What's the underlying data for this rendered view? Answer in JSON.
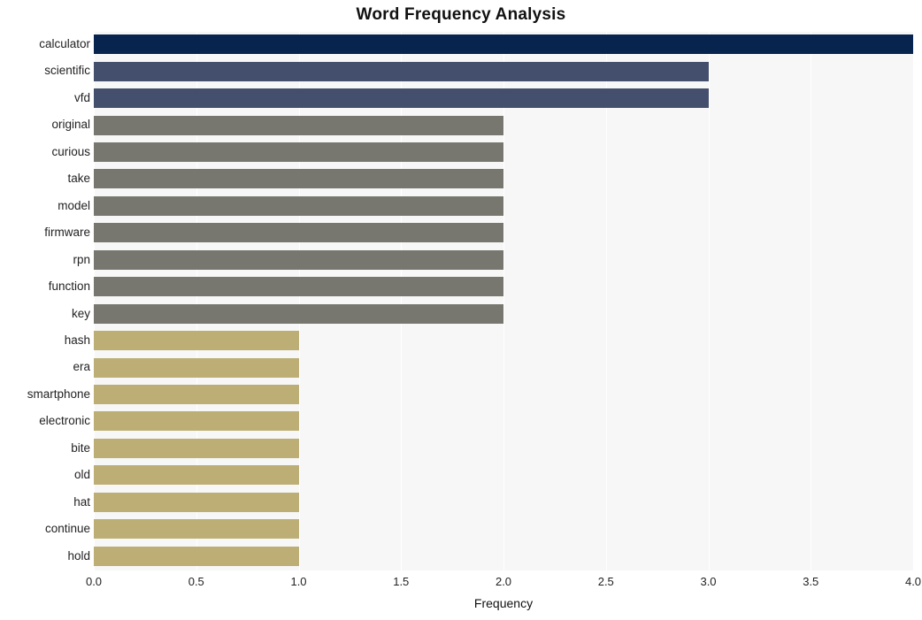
{
  "chart_data": {
    "type": "bar",
    "orientation": "horizontal",
    "title": "Word Frequency Analysis",
    "xlabel": "Frequency",
    "ylabel": "",
    "xlim": [
      0,
      4.0
    ],
    "xticks": [
      "0.0",
      "0.5",
      "1.0",
      "1.5",
      "2.0",
      "2.5",
      "3.0",
      "3.5",
      "4.0"
    ],
    "xtick_values": [
      0.0,
      0.5,
      1.0,
      1.5,
      2.0,
      2.5,
      3.0,
      3.5,
      4.0
    ],
    "grid": true,
    "grid_axis": "x",
    "legend": "none",
    "categories": [
      "calculator",
      "scientific",
      "vfd",
      "original",
      "curious",
      "take",
      "model",
      "firmware",
      "rpn",
      "function",
      "key",
      "hash",
      "era",
      "smartphone",
      "electronic",
      "bite",
      "old",
      "hat",
      "continue",
      "hold"
    ],
    "values": [
      4,
      3,
      3,
      2,
      2,
      2,
      2,
      2,
      2,
      2,
      2,
      1,
      1,
      1,
      1,
      1,
      1,
      1,
      1,
      1
    ],
    "bar_colors": [
      "#06244d",
      "#434f6c",
      "#434f6c",
      "#77776f",
      "#77776f",
      "#77776f",
      "#77776f",
      "#77776f",
      "#77776f",
      "#77776f",
      "#77776f",
      "#bcae74",
      "#bcae74",
      "#bcae74",
      "#bcae74",
      "#bcae74",
      "#bcae74",
      "#bcae74",
      "#bcae74",
      "#bcae74"
    ],
    "palette": {
      "freq_4": "#06244d",
      "freq_3": "#434f6c",
      "freq_2": "#77776f",
      "freq_1": "#bcae74"
    },
    "plot_background": "#f7f7f7",
    "gridline_color": "#ffffff",
    "figure_background": "#ffffff"
  }
}
